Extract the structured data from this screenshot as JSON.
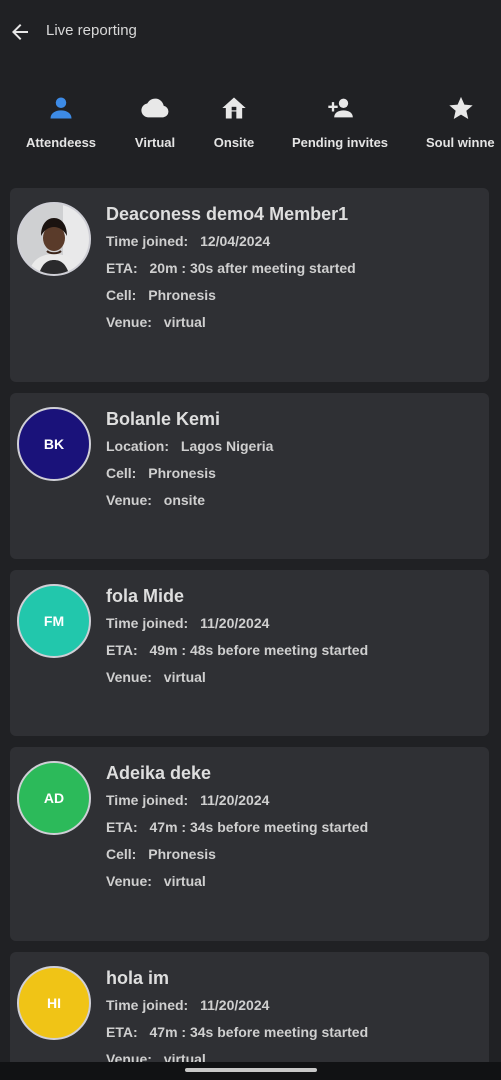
{
  "header": {
    "title": "Live reporting",
    "back_icon": "arrow-left-icon"
  },
  "tabs": [
    {
      "label": "Attendeess",
      "icon": "person-icon",
      "color": "#3d8be6",
      "active": true
    },
    {
      "label": "Virtual",
      "icon": "cloud-icon",
      "color": "#e8e8e8"
    },
    {
      "label": "Onsite",
      "icon": "home-icon",
      "color": "#e8e8e8"
    },
    {
      "label": "Pending invites",
      "icon": "add-person-icon",
      "color": "#e8e8e8"
    },
    {
      "label": "Soul winne",
      "icon": "star-icon",
      "color": "#e8e8e8"
    }
  ],
  "members": [
    {
      "name": "Deaconess demo4 Member1",
      "avatar": {
        "type": "photo",
        "initials": "",
        "color": "#dcdcdc"
      },
      "rows": [
        {
          "key": "Time joined:",
          "value": "12/04/2024"
        },
        {
          "key": "ETA:",
          "value": "20m : 30s after meeting started"
        },
        {
          "key": "Cell:",
          "value": "Phronesis"
        },
        {
          "key": "Venue:",
          "value": "virtual"
        }
      ]
    },
    {
      "name": "Bolanle Kemi",
      "avatar": {
        "type": "initials",
        "initials": "BK",
        "color": "#1a127a"
      },
      "rows": [
        {
          "key": "Location:",
          "value": "Lagos Nigeria"
        },
        {
          "key": "Cell:",
          "value": "Phronesis"
        },
        {
          "key": "Venue:",
          "value": "onsite"
        }
      ]
    },
    {
      "name": "fola Mide",
      "avatar": {
        "type": "initials",
        "initials": "FM",
        "color": "#22c7ac"
      },
      "rows": [
        {
          "key": "Time joined:",
          "value": "11/20/2024"
        },
        {
          "key": "ETA:",
          "value": "49m : 48s before meeting started"
        },
        {
          "key": "Venue:",
          "value": "virtual"
        }
      ]
    },
    {
      "name": "Adeika deke",
      "avatar": {
        "type": "initials",
        "initials": "AD",
        "color": "#2cba5a"
      },
      "rows": [
        {
          "key": "Time joined:",
          "value": "11/20/2024"
        },
        {
          "key": "ETA:",
          "value": "47m : 34s before meeting started"
        },
        {
          "key": "Cell:",
          "value": "Phronesis"
        },
        {
          "key": "Venue:",
          "value": "virtual"
        }
      ]
    },
    {
      "name": "hola im",
      "avatar": {
        "type": "initials",
        "initials": "HI",
        "color": "#f0c416"
      },
      "rows": [
        {
          "key": "Time joined:",
          "value": "11/20/2024"
        },
        {
          "key": "ETA:",
          "value": "47m : 34s before meeting started"
        },
        {
          "key": "Venue:",
          "value": "virtual"
        }
      ]
    }
  ]
}
